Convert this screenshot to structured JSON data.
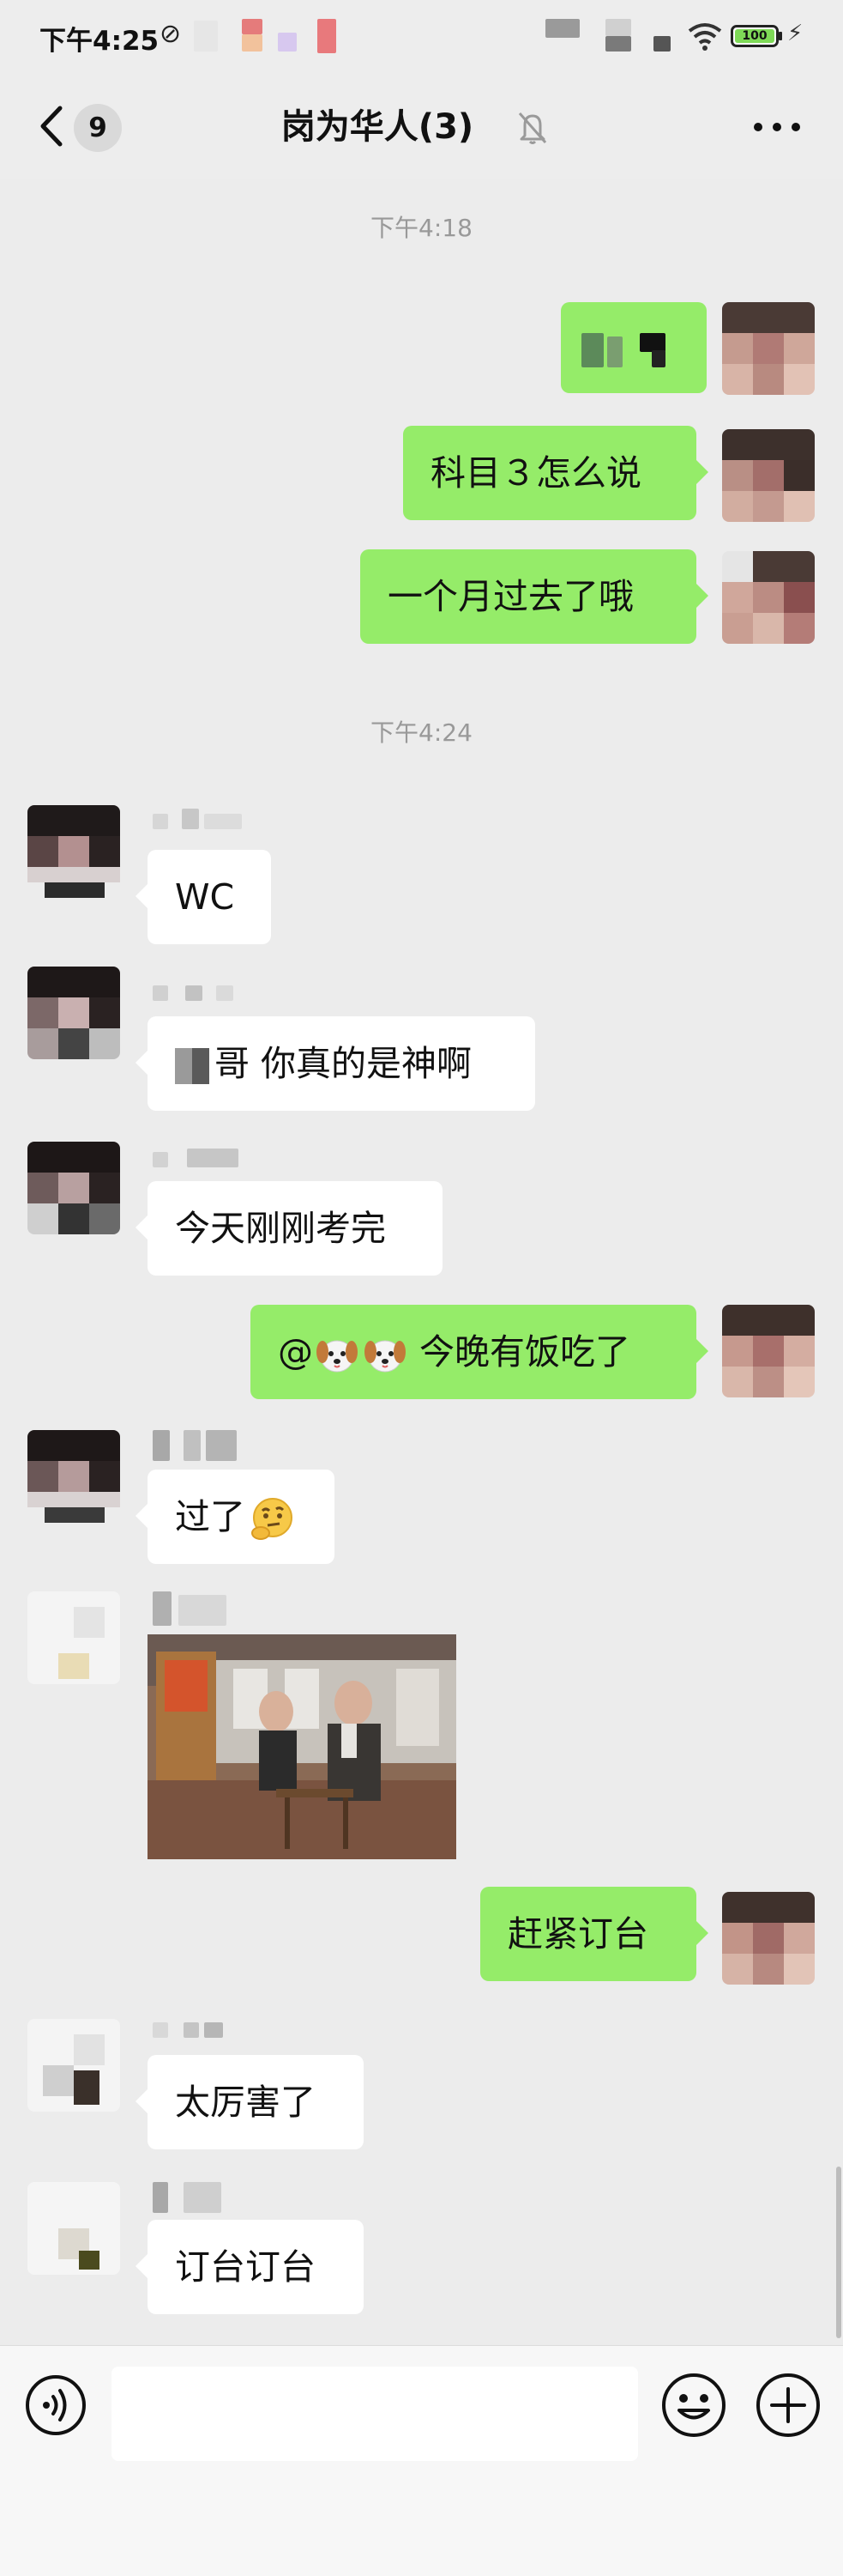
{
  "status_bar": {
    "time": "下午4:25",
    "mute_glyph": "⊘",
    "battery": "100",
    "charging_glyph": "⚡"
  },
  "nav": {
    "unread_count": "9",
    "title": "岗为华人(3)"
  },
  "messages": {
    "timestamp_1": "下午4:18",
    "m2": "科目３怎么说",
    "m3": "一个月过去了哦",
    "timestamp_2": "下午4:24",
    "m4": "WC",
    "m5": "哥 你真的是神啊",
    "m6": "今天刚刚考完",
    "m7_prefix": "@",
    "m7_text": "今晚有饭吃了",
    "m8": "过了",
    "m10": "赶紧订台",
    "m11": "太厉害了",
    "m12": "订台订台"
  },
  "input": {
    "placeholder": ""
  },
  "icons": {
    "back": "chevron-left-icon",
    "mute": "bell-off-icon",
    "more": "more-horizontal-icon",
    "voice": "voice-icon",
    "emoji": "emoji-icon",
    "plus": "plus-icon",
    "dog_emoji": "dog-face-emoji-icon",
    "thinking_emoji": "thinking-face-emoji-icon"
  },
  "colors": {
    "background": "#ececec",
    "outgoing_bubble": "#95ec69",
    "incoming_bubble": "#ffffff",
    "timestamp_text": "#999999"
  }
}
